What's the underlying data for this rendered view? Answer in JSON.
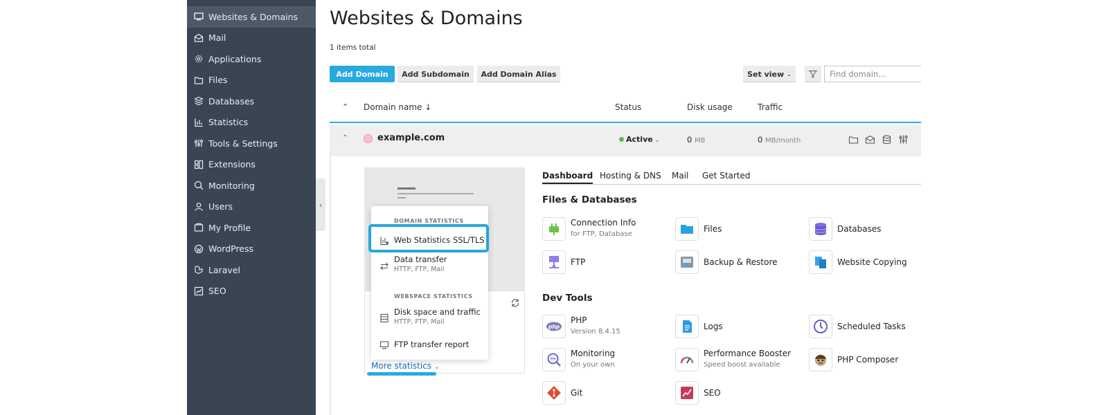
{
  "sidebar": {
    "items": [
      {
        "label": "Websites & Domains",
        "icon": "monitor-icon"
      },
      {
        "label": "Mail",
        "icon": "mail-icon"
      },
      {
        "label": "Applications",
        "icon": "gear-icon"
      },
      {
        "label": "Files",
        "icon": "folder-icon"
      },
      {
        "label": "Databases",
        "icon": "database-icon"
      },
      {
        "label": "Statistics",
        "icon": "bar-chart-icon"
      },
      {
        "label": "Tools & Settings",
        "icon": "sliders-icon"
      },
      {
        "label": "Extensions",
        "icon": "puzzle-icon"
      },
      {
        "label": "Monitoring",
        "icon": "magnifier-icon"
      },
      {
        "label": "Users",
        "icon": "user-icon"
      },
      {
        "label": "My Profile",
        "icon": "profile-icon"
      },
      {
        "label": "WordPress",
        "icon": "wordpress-icon"
      },
      {
        "label": "Laravel",
        "icon": "laravel-icon"
      },
      {
        "label": "SEO",
        "icon": "seo-chart-icon"
      }
    ]
  },
  "page": {
    "title": "Websites & Domains",
    "items_total": "1 items total"
  },
  "toolbar": {
    "add_domain": "Add Domain",
    "add_subdomain": "Add Subdomain",
    "add_alias": "Add Domain Alias",
    "set_view": "Set view",
    "search_placeholder": "Find domain..."
  },
  "table": {
    "headers": {
      "domain": "Domain name ↓",
      "status": "Status",
      "disk": "Disk usage",
      "traffic": "Traffic"
    },
    "row": {
      "domain": "example.com",
      "status": "Active",
      "disk_value": "0",
      "disk_unit": "MB",
      "traffic_value": "0",
      "traffic_unit": "MB/month"
    }
  },
  "preview": {
    "more_statistics": "More statistics"
  },
  "stats_menu": {
    "domain_heading": "DOMAIN STATISTICS",
    "web_stats": "Web Statistics SSL/TLS",
    "data_transfer": "Data transfer",
    "data_transfer_sub": "HTTP, FTP, Mail",
    "webspace_heading": "WEBSPACE STATISTICS",
    "disk_traffic": "Disk space and traffic",
    "disk_traffic_sub": "HTTP, FTP, Mail",
    "ftp_report": "FTP transfer report"
  },
  "tabs": [
    "Dashboard",
    "Hosting & DNS",
    "Mail",
    "Get Started"
  ],
  "sections": {
    "files_db": "Files & Databases",
    "dev_tools": "Dev Tools"
  },
  "tools": {
    "connection_info": {
      "name": "Connection Info",
      "desc": "for FTP, Database"
    },
    "files": {
      "name": "Files"
    },
    "databases": {
      "name": "Databases"
    },
    "ftp": {
      "name": "FTP"
    },
    "backup": {
      "name": "Backup & Restore"
    },
    "website_copying": {
      "name": "Website Copying"
    },
    "php": {
      "name": "PHP",
      "desc": "Version 8.4.15"
    },
    "logs": {
      "name": "Logs"
    },
    "scheduled_tasks": {
      "name": "Scheduled Tasks"
    },
    "monitoring": {
      "name": "Monitoring",
      "desc": "On your own"
    },
    "performance_booster": {
      "name": "Performance Booster",
      "desc": "Speed boost available"
    },
    "php_composer": {
      "name": "PHP Composer"
    },
    "git": {
      "name": "Git"
    },
    "seo": {
      "name": "SEO"
    }
  },
  "colors": {
    "sidebar": "#3a4553",
    "accent": "#28aae1",
    "active": "#5cb85c"
  }
}
